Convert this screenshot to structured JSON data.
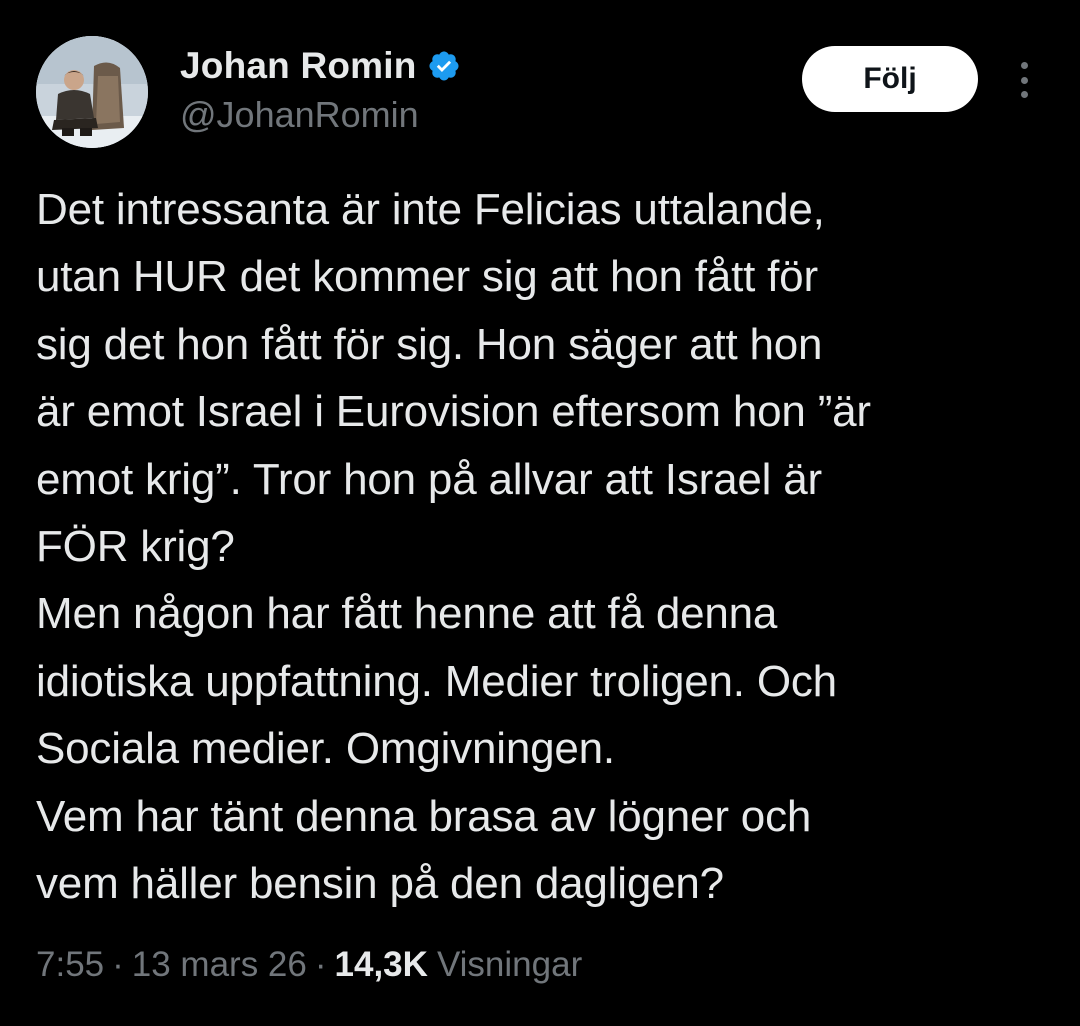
{
  "author": {
    "display_name": "Johan Romin",
    "handle": "@JohanRomin",
    "verified": true,
    "avatar_icon": "user-avatar-photo"
  },
  "actions": {
    "follow_label": "Följ",
    "more_icon": "more-vertical-icon"
  },
  "tweet": {
    "lines": [
      "Det intressanta är inte Felicias uttalande,",
      "utan HUR det kommer sig att hon fått för",
      "sig det hon fått för sig. Hon säger att hon",
      "är emot Israel i Eurovision eftersom hon ”är",
      "emot krig”. Tror hon på allvar att Israel är",
      "FÖR krig?",
      "Men någon har fått henne att få denna",
      "idiotiska uppfattning. Medier troligen. Och",
      "Sociala medier. Omgivningen.",
      "Vem har tänt denna brasa av lögner och",
      "vem häller bensin på den dagligen?"
    ]
  },
  "meta": {
    "time": "7:55",
    "separator": "·",
    "date": "13 mars 26",
    "views_count": "14,3K",
    "views_label": "Visningar"
  },
  "colors": {
    "background": "#000000",
    "text_primary": "#e7e9ea",
    "text_secondary": "#71767b",
    "verified_blue": "#1d9bf0",
    "follow_bg": "#ffffff",
    "follow_text": "#0f1419"
  }
}
